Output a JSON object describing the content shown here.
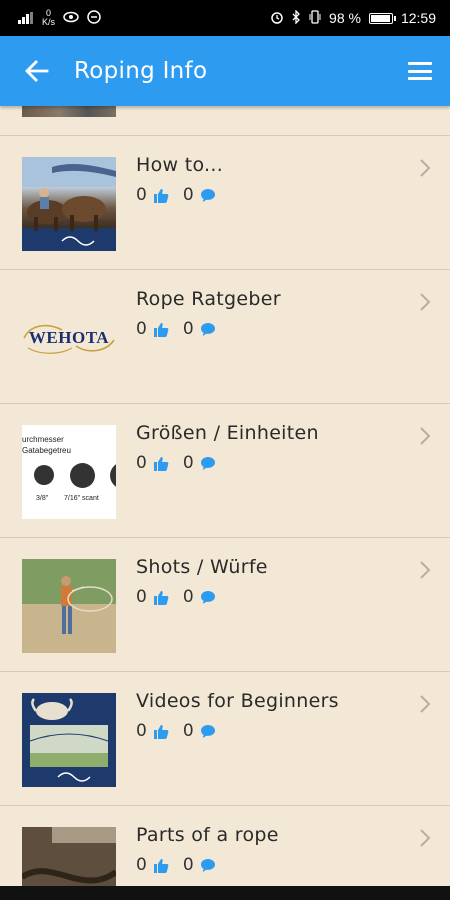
{
  "status_bar": {
    "net_speed_value": "0",
    "net_speed_unit": "K/s",
    "battery_text": "98 %",
    "battery_level": 0.98,
    "time": "12:59"
  },
  "app_bar": {
    "title": "Roping Info",
    "back_icon": "arrow-left-icon",
    "menu_icon": "hamburger-menu-icon",
    "color": "#2C9BF0"
  },
  "theme": {
    "background": "#F3E8D6",
    "accent": "#2C9BF0"
  },
  "items": [
    {
      "title": "How to...",
      "likes": "0",
      "comments": "0"
    },
    {
      "title": "Rope Ratgeber",
      "likes": "0",
      "comments": "0",
      "thumb_text": "WEHOTA"
    },
    {
      "title": "Größen / Einheiten",
      "likes": "0",
      "comments": "0",
      "thumb_lines": [
        "urchmesser",
        "Gatabegetreu"
      ],
      "thumb_labels": [
        "3/8\"",
        "7/16\" scant"
      ]
    },
    {
      "title": "Shots / Würfe",
      "likes": "0",
      "comments": "0"
    },
    {
      "title": "Videos for Beginners",
      "likes": "0",
      "comments": "0"
    },
    {
      "title": "Parts of a rope",
      "likes": "0",
      "comments": "0"
    }
  ]
}
